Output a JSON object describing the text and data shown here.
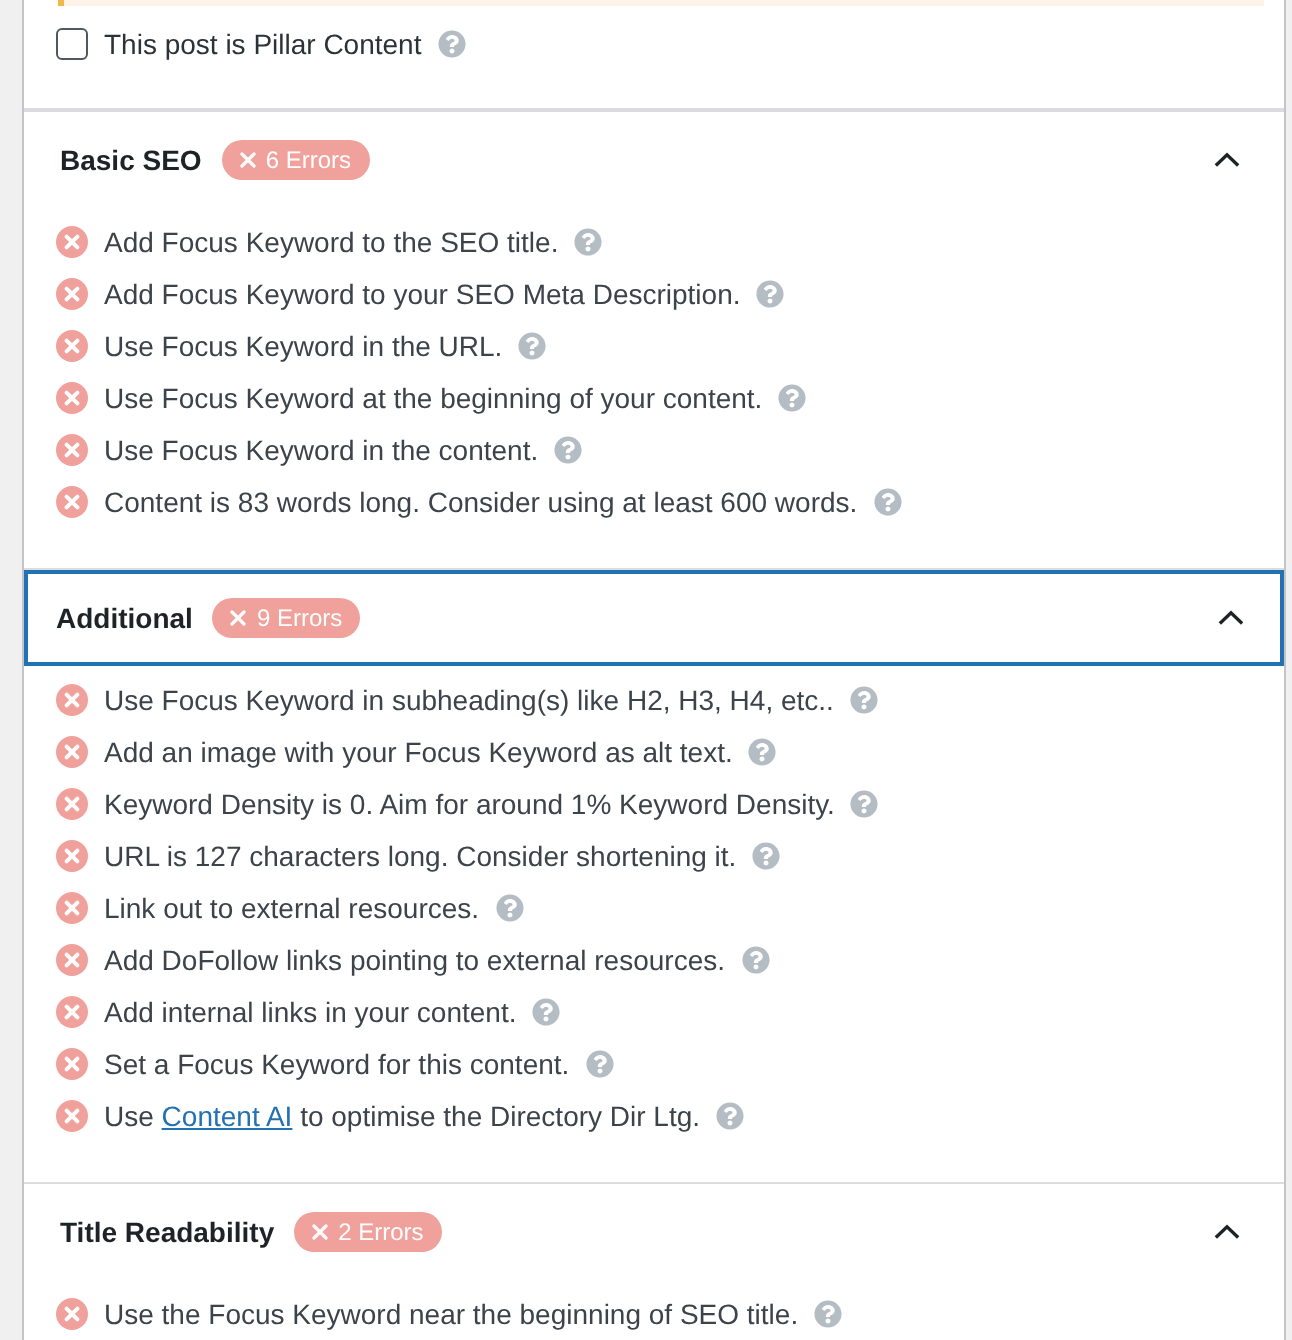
{
  "pillar_content": {
    "label": "This post is Pillar Content",
    "checked": false
  },
  "sections": [
    {
      "title": "Basic SEO",
      "badge": "6 Errors",
      "expanded": true,
      "focused": false,
      "items": [
        {
          "passed": false,
          "text": "Add Focus Keyword to the SEO title."
        },
        {
          "passed": false,
          "text": "Add Focus Keyword to your SEO Meta Description."
        },
        {
          "passed": false,
          "text": "Use Focus Keyword in the URL."
        },
        {
          "passed": false,
          "text": "Use Focus Keyword at the beginning of your content."
        },
        {
          "passed": false,
          "text": "Use Focus Keyword in the content."
        },
        {
          "passed": false,
          "text": "Content is 83 words long. Consider using at least 600 words."
        }
      ]
    },
    {
      "title": "Additional",
      "badge": "9 Errors",
      "expanded": true,
      "focused": true,
      "items": [
        {
          "passed": false,
          "text": "Use Focus Keyword in subheading(s) like H2, H3, H4, etc.."
        },
        {
          "passed": false,
          "text": "Add an image with your Focus Keyword as alt text."
        },
        {
          "passed": false,
          "text": "Keyword Density is 0. Aim for around 1% Keyword Density."
        },
        {
          "passed": false,
          "text": "URL is 127 characters long. Consider shortening it."
        },
        {
          "passed": false,
          "text": "Link out to external resources."
        },
        {
          "passed": false,
          "text": "Add DoFollow links pointing to external resources."
        },
        {
          "passed": false,
          "text": "Add internal links in your content."
        },
        {
          "passed": false,
          "text": "Set a Focus Keyword for this content."
        },
        {
          "passed": false,
          "text": "Use",
          "link": "Content AI",
          "text_after": "to optimise the Directory Dir Ltg."
        }
      ]
    },
    {
      "title": "Title Readability",
      "badge": "2 Errors",
      "expanded": true,
      "focused": false,
      "items": [
        {
          "passed": false,
          "text": "Use the Focus Keyword near the beginning of SEO title."
        }
      ]
    }
  ]
}
